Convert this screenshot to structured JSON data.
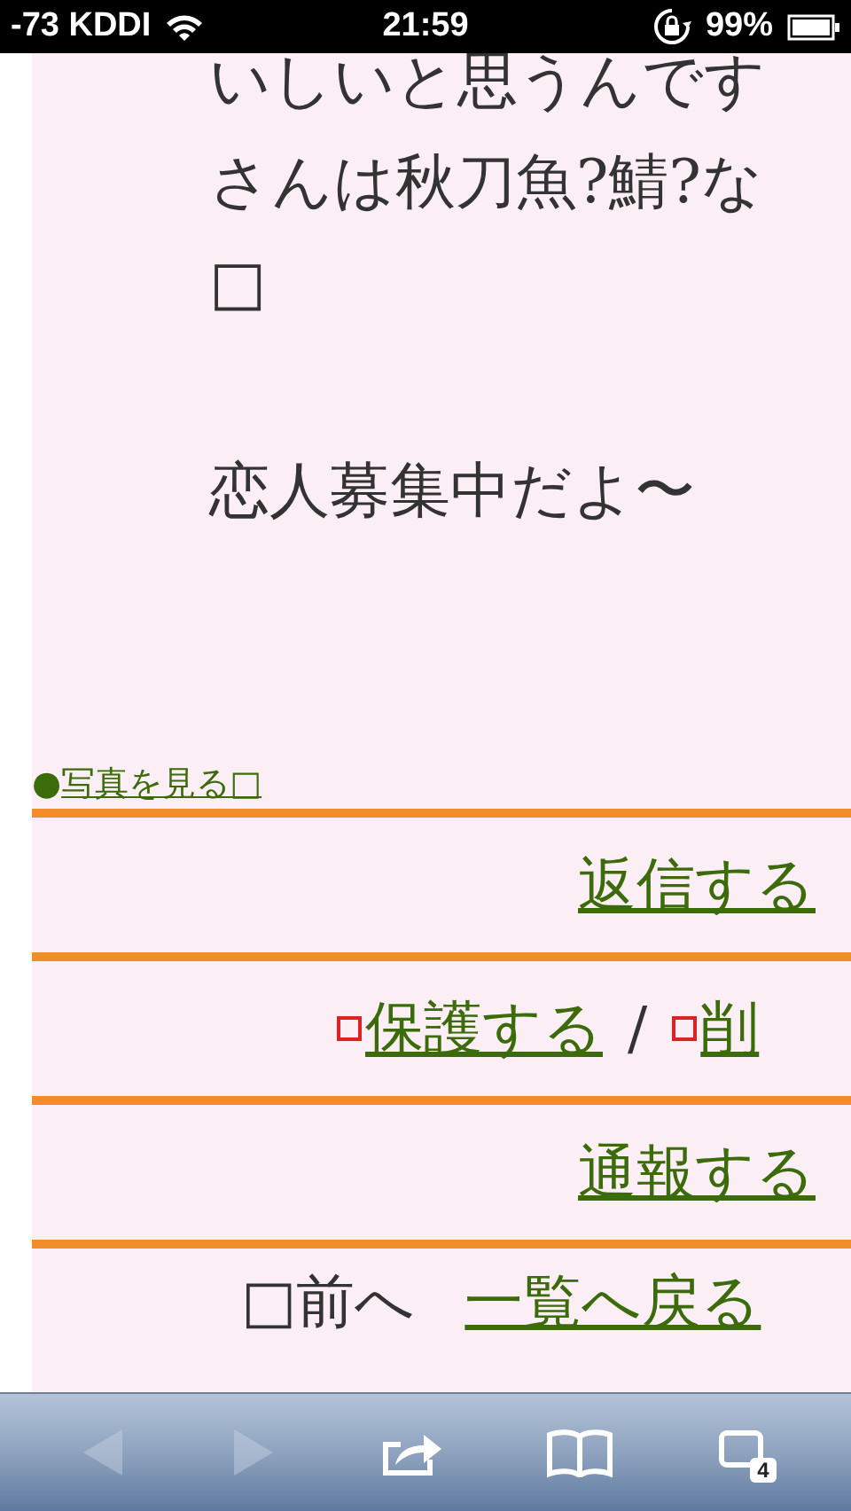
{
  "status_bar": {
    "carrier": "-73 KDDI",
    "time": "21:59",
    "battery": "99%"
  },
  "message": {
    "lines": [
      "いしいと思うんです",
      "さんは秋刀魚?鯖?な",
      "□"
    ],
    "closing": "恋人募集中だよ〜"
  },
  "photo_link": {
    "bullet": "●",
    "label": "写真を見る□"
  },
  "actions": [
    {
      "kind": "single",
      "items": [
        {
          "label": "返信する"
        }
      ]
    },
    {
      "kind": "pair",
      "items": [
        {
          "label": "保護する"
        },
        {
          "label": "削"
        }
      ],
      "separator": "/"
    },
    {
      "kind": "single",
      "items": [
        {
          "label": "通報する"
        }
      ]
    }
  ],
  "nav": {
    "prev": "□前へ",
    "back_to_list": "一覧へ戻る"
  },
  "toolbar": {
    "back_disabled": true,
    "forward_disabled": true,
    "tab_count": "4"
  }
}
